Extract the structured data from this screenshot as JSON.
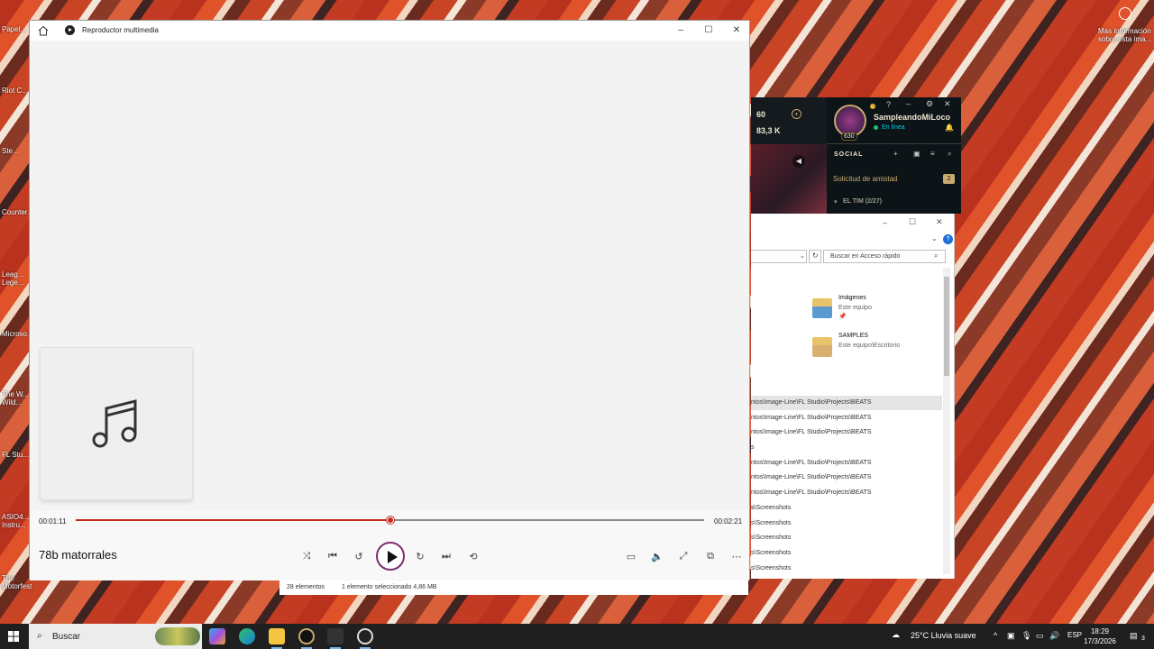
{
  "desktop": {
    "left_icons": [
      "Papel...",
      "Riot C...",
      "Ste...",
      "Counter...",
      "Leag... Lege...",
      "Microso...",
      "The W... Wild...",
      "FL Stu...",
      "ASIO4... Instru...",
      "The Motorfest"
    ],
    "right_icons": [
      "Más información sobre esta ima..."
    ]
  },
  "player": {
    "app_title": "Reproductor multimedia",
    "elapsed": "00:01:11",
    "duration": "00:02:21",
    "progress": 0.5,
    "song_title": "78b matorrales",
    "accent_color": "#c42b1c",
    "play_ring_color": "#7a2e6e"
  },
  "game_client": {
    "currency_1": "60",
    "currency_2": "83,3 K",
    "level": "630",
    "summoner_name": "SampleandoMiLoco",
    "status": "En línea",
    "social_label": "SOCIAL",
    "friend_request": "Solicitud de amistad",
    "friend_request_count": "2",
    "group_label": "EL TIM (2/27)"
  },
  "explorer": {
    "search_placeholder": "Buscar en Acceso rápido",
    "folders": [
      {
        "title": "Imágenes",
        "subtitle": "Este equipo"
      },
      {
        "title": "SAMPLES",
        "subtitle": "Este equipo\\Escritorio"
      }
    ],
    "paths": [
      "ntos\\Image-Line\\FL Studio\\Projects\\BEATS",
      "ntos\\Image-Line\\FL Studio\\Projects\\BEATS",
      "ntos\\Image-Line\\FL Studio\\Projects\\BEATS",
      "s",
      "ntos\\Image-Line\\FL Studio\\Projects\\BEATS",
      "ntos\\Image-Line\\FL Studio\\Projects\\BEATS",
      "ntos\\Image-Line\\FL Studio\\Projects\\BEATS",
      "s",
      "s\\Screenshots",
      "s\\Screenshots",
      "s\\Screenshots",
      "s\\Screenshots",
      "s\\Screenshots"
    ],
    "status_count": "28 elementos",
    "status_selected": "1 elemento seleccionado  4,86 MB"
  },
  "taskbar": {
    "search_label": "Buscar",
    "weather": "25°C  Lluvia suave",
    "language": "ESP",
    "time": "18:29",
    "date": "17/3/2026",
    "notification_count": "3"
  }
}
